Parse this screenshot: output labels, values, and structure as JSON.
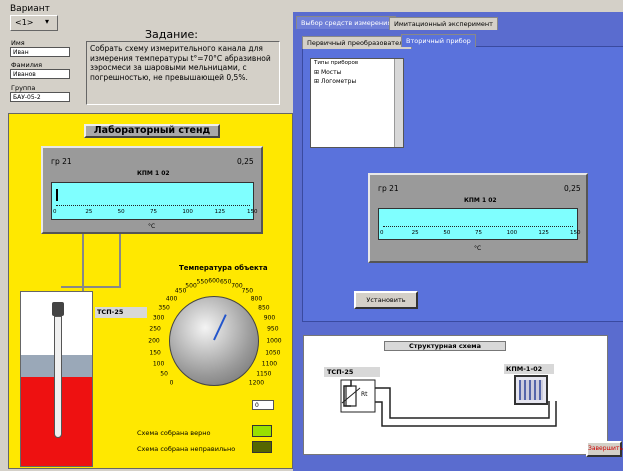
{
  "variant": {
    "label": "Вариант",
    "value": "<1>"
  },
  "fields": {
    "name_label": "Имя",
    "name_value": "Иван",
    "surname_label": "Фамилия",
    "surname_value": "Иванов",
    "group_label": "Группа",
    "group_value": "БАУ-05-2"
  },
  "task": {
    "title": "Задание:",
    "text": "Собрать схему измерительного канала для измерения температуры t°=70°C абразивной зэросмеси за шаровыми мельницами, с погрешностью, не превышающей 0,5%."
  },
  "stand": {
    "title": "Лабораторный стенд",
    "instrument": {
      "group": "гр 21",
      "class": "0,25",
      "model": "КПМ 1 02",
      "unit": "°C",
      "ticks": [
        "0",
        "25",
        "50",
        "75",
        "100",
        "125",
        "150"
      ],
      "pointer_value": 0
    },
    "sensor_label": "ТСП-25",
    "dial": {
      "title": "Температура объекта",
      "labels": [
        "0",
        "50",
        "100",
        "150",
        "200",
        "250",
        "300",
        "350",
        "400",
        "450",
        "500",
        "550",
        "600",
        "650",
        "700",
        "750",
        "800",
        "850",
        "900",
        "950",
        "1000",
        "1050",
        "1100",
        "1150",
        "1200"
      ],
      "value_field": "0",
      "value": 0
    },
    "status_ok": "Схема собрана верно",
    "status_bad": "Схема собрана неправильно",
    "colors": {
      "background": "#ffe800",
      "led_ok": "#99e000",
      "led_bad": "#556600"
    }
  },
  "tabs": {
    "main": [
      "Выбор средств измерения",
      "Имитационный эксперимент"
    ],
    "sub": [
      "Первичный преобразователь",
      "Вторичный прибор"
    ]
  },
  "tree": {
    "header": "Типы приборов",
    "items": [
      "Мосты",
      "Логометры"
    ]
  },
  "selector_instrument": {
    "group": "гр 21",
    "class": "0,25",
    "model": "КПМ 1 02",
    "unit": "°C",
    "ticks": [
      "0",
      "25",
      "50",
      "75",
      "100",
      "125",
      "150"
    ]
  },
  "install_button": "Установить",
  "schema": {
    "title": "Структурная схема",
    "sensor_label": "ТСП-25",
    "resistor_label": "Rt",
    "instrument_label": "КПМ-1-02"
  },
  "finish_button": "Завершить"
}
